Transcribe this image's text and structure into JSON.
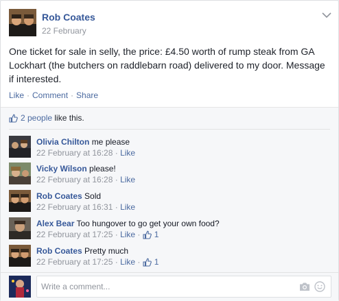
{
  "post": {
    "author": "Rob Coates",
    "date": "22 February",
    "text": "One ticket for sale in selly, the price: £4.50 worth of rump steak from GA Lockhart (the butchers on raddlebarn road) delivered to my door. Message if interested.",
    "actions": {
      "like": "Like",
      "comment": "Comment",
      "share": "Share",
      "separator": "·"
    }
  },
  "likes": {
    "count_link": "2 people",
    "suffix": "like this."
  },
  "comments": [
    {
      "name": "Olivia Chilton",
      "text": "me please",
      "time": "22 February at 16:28",
      "like": "Like",
      "likes": ""
    },
    {
      "name": "Vicky Wilson",
      "text": "please!",
      "time": "22 February at 16:28",
      "like": "Like",
      "likes": ""
    },
    {
      "name": "Rob Coates",
      "text": "Sold",
      "time": "22 February at 16:31",
      "like": "Like",
      "likes": ""
    },
    {
      "name": "Alex Bear",
      "text": "Too hungover to go get your own food?",
      "time": "22 February at 17:25",
      "like": "Like",
      "likes": "1"
    },
    {
      "name": "Rob Coates",
      "text": "Pretty much",
      "time": "22 February at 17:25",
      "like": "Like",
      "likes": "1"
    }
  ],
  "composer": {
    "placeholder": "Write a comment..."
  },
  "colors": {
    "link": "#365899",
    "meta": "#90949c",
    "accent": "#4b6aa0"
  },
  "icons": [
    "chevron-down-icon",
    "thumbs-up-icon",
    "camera-icon",
    "smiley-icon"
  ]
}
